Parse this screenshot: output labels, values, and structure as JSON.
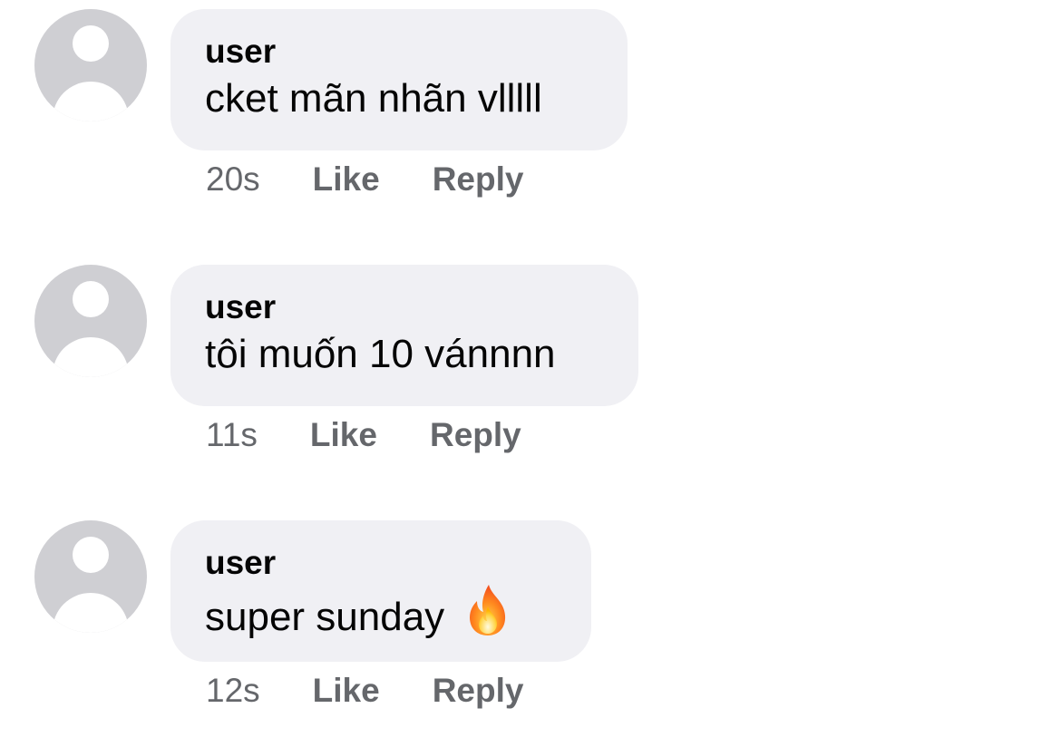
{
  "comments": [
    {
      "author": "user",
      "text": "cket mãn nhãn vlllll",
      "time": "20s",
      "like_label": "Like",
      "reply_label": "Reply",
      "emoji": ""
    },
    {
      "author": "user",
      "text": "tôi muốn 10 vánnnn",
      "time": "11s",
      "like_label": "Like",
      "reply_label": "Reply",
      "emoji": ""
    },
    {
      "author": "user",
      "text": "super sunday",
      "time": "12s",
      "like_label": "Like",
      "reply_label": "Reply",
      "emoji": "fire-icon"
    }
  ]
}
